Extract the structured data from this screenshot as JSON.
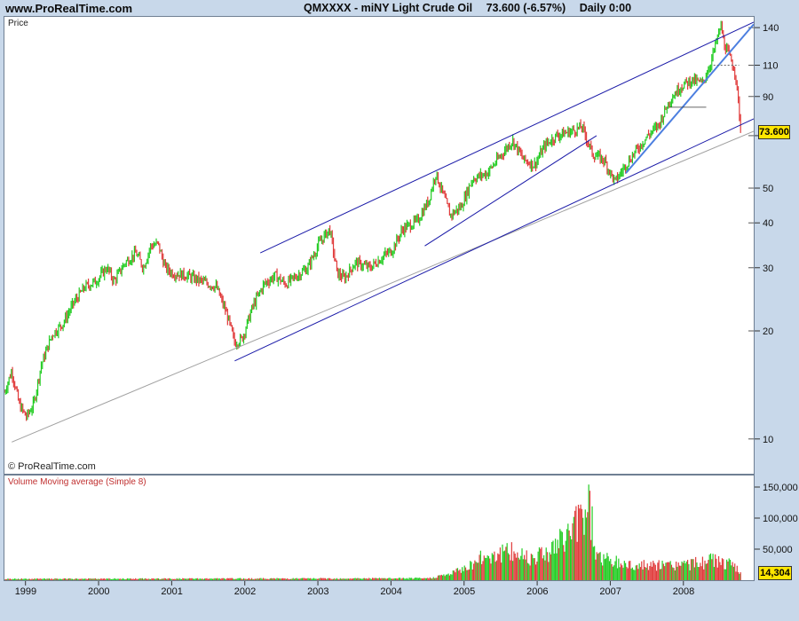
{
  "header": {
    "site": "www.ProRealTime.com",
    "symbol": "QMXXXX - miNY Light Crude Oil",
    "last": "73.600 (-6.57%)",
    "timeframe": "Daily  0:00"
  },
  "price_panel": {
    "label": "Price",
    "copyright": "© ProRealTime.com",
    "price_badge": "73.600"
  },
  "volume_panel": {
    "label": "Volume Moving average (Simple 8)",
    "volume_badge": "14,304"
  },
  "colors": {
    "up": "#22cc22",
    "down": "#e03a3a",
    "trend": "#1a1aa8",
    "trend_light": "#4c7fe0",
    "reg": "#a0a0a0",
    "bg": "#c8d8ea"
  },
  "chart_data": [
    {
      "type": "line",
      "title": "QMXXXX - miNY Light Crude Oil",
      "yscale": "log",
      "yticks": [
        10,
        20,
        30,
        40,
        50,
        70,
        90,
        110,
        140
      ],
      "ytick_labels": [
        "10",
        "20",
        "30",
        "40",
        "50",
        "70",
        "90",
        "110",
        "140"
      ],
      "ylim": [
        8,
        150
      ],
      "x_labels": [
        "1999",
        "2000",
        "2001",
        "2002",
        "2003",
        "2004",
        "2005",
        "2006",
        "2007",
        "2008"
      ],
      "xlim": [
        1998.7,
        2008.95
      ],
      "series": [
        {
          "name": "Price",
          "x": [
            1998.7,
            1998.8,
            1998.9,
            1999.0,
            1999.1,
            1999.2,
            1999.35,
            1999.5,
            1999.65,
            1999.8,
            1999.95,
            2000.1,
            2000.2,
            2000.35,
            2000.5,
            2000.6,
            2000.7,
            2000.8,
            2000.9,
            2001.0,
            2001.2,
            2001.4,
            2001.6,
            2001.75,
            2001.85,
            2001.95,
            2002.1,
            2002.25,
            2002.4,
            2002.55,
            2002.7,
            2002.85,
            2003.0,
            2003.15,
            2003.25,
            2003.35,
            2003.5,
            2003.7,
            2003.9,
            2004.0,
            2004.15,
            2004.35,
            2004.5,
            2004.6,
            2004.8,
            2004.95,
            2005.1,
            2005.3,
            2005.5,
            2005.65,
            2005.8,
            2005.95,
            2006.1,
            2006.25,
            2006.45,
            2006.6,
            2006.75,
            2006.9,
            2007.05,
            2007.2,
            2007.35,
            2007.5,
            2007.65,
            2007.8,
            2007.95,
            2008.1,
            2008.25,
            2008.35,
            2008.45,
            2008.5,
            2008.55,
            2008.62,
            2008.7,
            2008.77
          ],
          "y": [
            13.5,
            15.5,
            12.5,
            11.5,
            12.5,
            16.0,
            19.5,
            21.0,
            24.0,
            26.5,
            27.5,
            30.0,
            27.5,
            31.0,
            33.0,
            30.0,
            34.5,
            35.0,
            30.0,
            29.0,
            28.5,
            27.5,
            26.5,
            22.0,
            18.5,
            19.0,
            23.5,
            27.0,
            28.5,
            27.0,
            28.5,
            30.0,
            35.0,
            38.5,
            29.0,
            28.0,
            31.0,
            30.0,
            32.5,
            33.5,
            38.5,
            40.5,
            46.0,
            55.0,
            42.0,
            44.5,
            53.0,
            55.0,
            62.0,
            68.0,
            60.0,
            58.0,
            66.0,
            70.0,
            72.0,
            74.0,
            62.0,
            60.0,
            52.0,
            58.0,
            64.0,
            70.0,
            75.0,
            88.0,
            96.0,
            100.0,
            98.0,
            110.0,
            130.0,
            142.0,
            125.0,
            116.0,
            105.0,
            73.6
          ]
        }
      ]
    },
    {
      "type": "bar",
      "title": "Volume Moving average (Simple 8)",
      "yticks": [
        50000,
        100000,
        150000
      ],
      "ytick_labels": [
        "50,000",
        "100,000",
        "150,000"
      ],
      "ylim": [
        0,
        160000
      ],
      "x": [
        1998.7,
        2004.5,
        2004.8,
        2005.0,
        2005.3,
        2005.6,
        2005.9,
        2006.2,
        2006.4,
        2006.55,
        2006.7,
        2006.8,
        2007.0,
        2007.3,
        2007.6,
        2007.9,
        2008.2,
        2008.4,
        2008.6,
        2008.77
      ],
      "values": [
        2000,
        3000,
        10000,
        20000,
        40000,
        45000,
        38000,
        50000,
        72000,
        95000,
        125000,
        40000,
        30000,
        24000,
        23000,
        25000,
        27000,
        33000,
        26000,
        14304
      ],
      "series_name": "Volume"
    }
  ]
}
